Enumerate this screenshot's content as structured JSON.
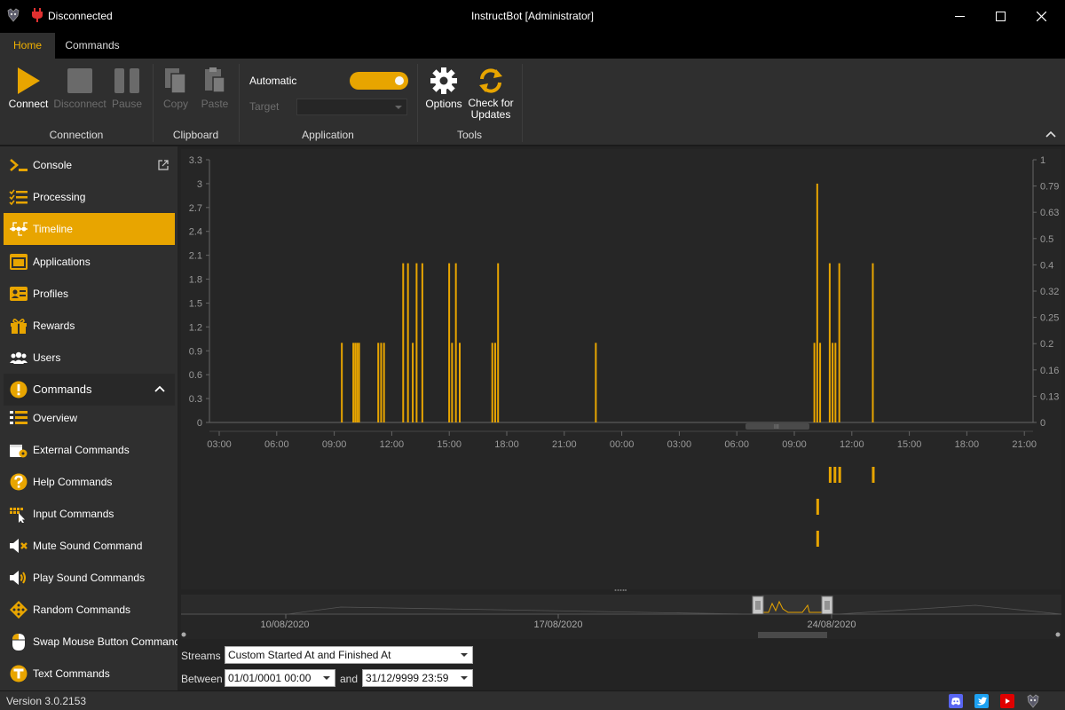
{
  "titlebar": {
    "status": "Disconnected",
    "title": "InstructBot [Administrator]"
  },
  "tabs": [
    {
      "label": "Home"
    },
    {
      "label": "Commands"
    }
  ],
  "ribbon": {
    "connection": {
      "label": "Connection",
      "connect": "Connect",
      "disconnect": "Disconnect",
      "pause": "Pause"
    },
    "clipboard": {
      "label": "Clipboard",
      "copy": "Copy",
      "paste": "Paste"
    },
    "application": {
      "label": "Application",
      "automatic": "Automatic",
      "target": "Target",
      "automatic_on": true
    },
    "tools": {
      "label": "Tools",
      "options": "Options",
      "check_updates_line1": "Check for",
      "check_updates_line2": "Updates"
    }
  },
  "sidebar": {
    "items": [
      {
        "label": "Console",
        "icon": "console-icon"
      },
      {
        "label": "Processing",
        "icon": "checklist-icon"
      },
      {
        "label": "Timeline",
        "icon": "timeline-icon"
      },
      {
        "label": "Applications",
        "icon": "application-window-icon"
      },
      {
        "label": "Profiles",
        "icon": "profile-card-icon"
      },
      {
        "label": "Rewards",
        "icon": "gift-icon"
      },
      {
        "label": "Users",
        "icon": "users-icon"
      },
      {
        "label": "Commands",
        "icon": "exclamation-icon"
      },
      {
        "label": "Overview",
        "icon": "list-icon"
      },
      {
        "label": "External Commands",
        "icon": "external-command-icon"
      },
      {
        "label": "Help Commands",
        "icon": "question-icon"
      },
      {
        "label": "Input Commands",
        "icon": "keyboard-cursor-icon"
      },
      {
        "label": "Mute Sound Command",
        "icon": "mute-icon"
      },
      {
        "label": "Play Sound Commands",
        "icon": "speaker-icon"
      },
      {
        "label": "Random Commands",
        "icon": "dice-icon"
      },
      {
        "label": "Swap Mouse Button Command",
        "icon": "mouse-icon"
      },
      {
        "label": "Text Commands",
        "icon": "text-t-icon"
      }
    ]
  },
  "chart_data": {
    "type": "bar",
    "title": "",
    "x_ticks": [
      "03:00",
      "06:00",
      "09:00",
      "12:00",
      "15:00",
      "18:00",
      "21:00",
      "00:00",
      "03:00",
      "06:00",
      "09:00",
      "12:00",
      "15:00",
      "18:00",
      "21:00"
    ],
    "y_left_ticks": [
      "0",
      "0.3",
      "0.6",
      "0.9",
      "1.2",
      "1.5",
      "1.8",
      "2.1",
      "2.4",
      "2.7",
      "3",
      "3.3"
    ],
    "y_right_ticks": [
      "0",
      "0.13",
      "0.16",
      "0.2",
      "0.25",
      "0.32",
      "0.4",
      "0.5",
      "0.63",
      "0.79",
      "1"
    ],
    "ylim": [
      0,
      3.3
    ],
    "series": [
      {
        "values": [
          {
            "x": 9.35,
            "y": 1
          },
          {
            "x": 9.95,
            "y": 1
          },
          {
            "x": 10.05,
            "y": 1
          },
          {
            "x": 10.15,
            "y": 1
          },
          {
            "x": 10.25,
            "y": 1
          },
          {
            "x": 11.25,
            "y": 1
          },
          {
            "x": 11.4,
            "y": 1
          },
          {
            "x": 11.55,
            "y": 1
          },
          {
            "x": 12.55,
            "y": 2
          },
          {
            "x": 12.8,
            "y": 2
          },
          {
            "x": 13.05,
            "y": 1
          },
          {
            "x": 13.25,
            "y": 2
          },
          {
            "x": 13.55,
            "y": 2
          },
          {
            "x": 14.95,
            "y": 2
          },
          {
            "x": 15.1,
            "y": 1
          },
          {
            "x": 15.3,
            "y": 2
          },
          {
            "x": 15.5,
            "y": 1
          },
          {
            "x": 17.2,
            "y": 1
          },
          {
            "x": 17.35,
            "y": 1
          },
          {
            "x": 17.5,
            "y": 2
          },
          {
            "x": 22.6,
            "y": 1
          },
          {
            "x": 34.0,
            "y": 1
          },
          {
            "x": 34.15,
            "y": 3
          },
          {
            "x": 34.3,
            "y": 1
          },
          {
            "x": 34.8,
            "y": 2
          },
          {
            "x": 34.95,
            "y": 1
          },
          {
            "x": 35.1,
            "y": 1
          },
          {
            "x": 35.3,
            "y": 2
          },
          {
            "x": 37.05,
            "y": 2
          }
        ]
      }
    ],
    "color": "#e8a500"
  },
  "navigator": {
    "dates": [
      "10/08/2020",
      "17/08/2020",
      "24/08/2020"
    ]
  },
  "filters": {
    "streams_label": "Streams",
    "streams_value": "Custom Started At and Finished At",
    "between_label": "Between",
    "between_from": "01/01/0001 00:00",
    "and_label": "and",
    "between_to": "31/12/9999 23:59"
  },
  "statusbar": {
    "version": "Version 3.0.2153"
  },
  "colors": {
    "accent": "#e8a500",
    "discord": "#5865f2",
    "twitter": "#1da1f2",
    "youtube": "#e00000"
  }
}
